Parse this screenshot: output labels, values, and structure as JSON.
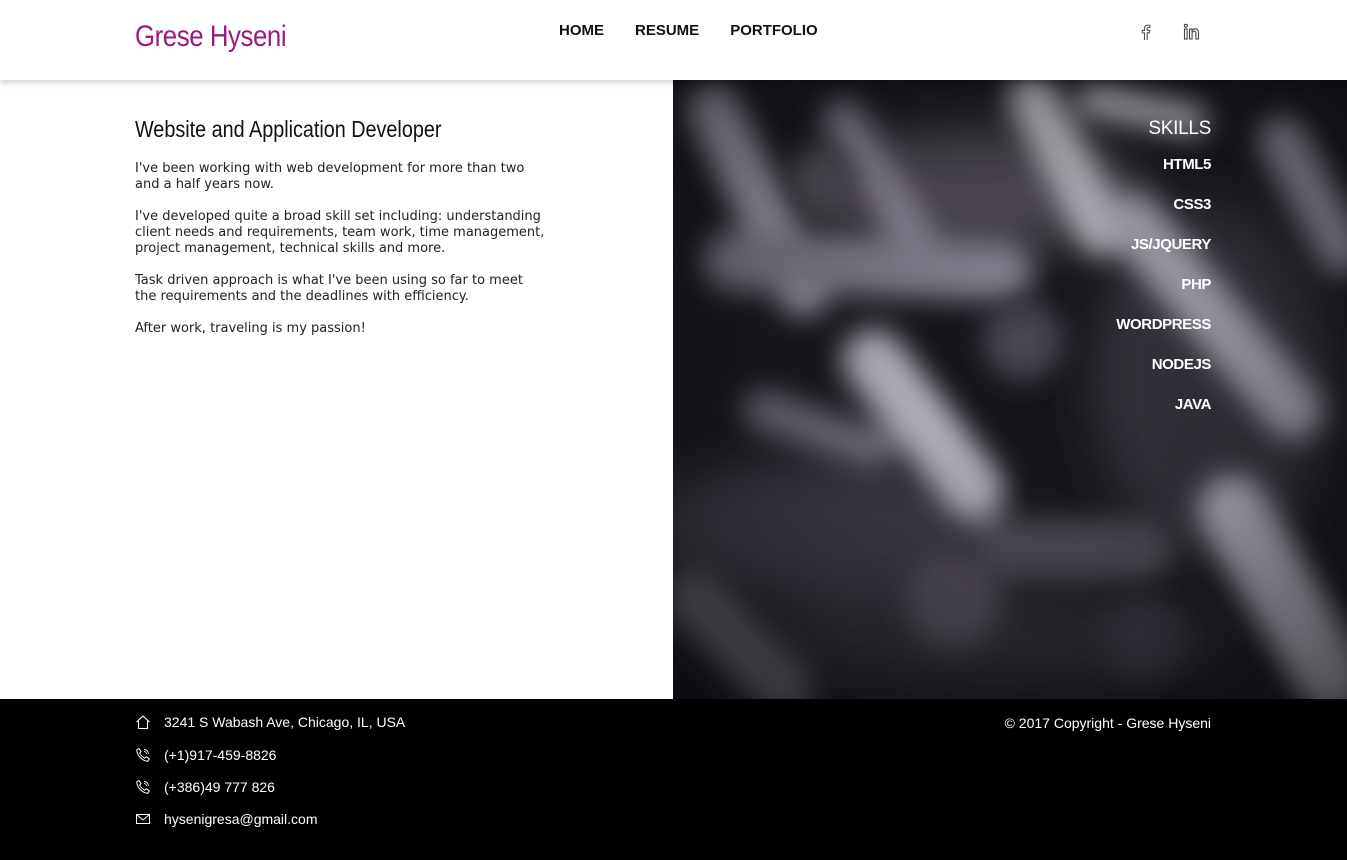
{
  "header": {
    "logo": "Grese Hyseni",
    "nav": [
      "HOME",
      "RESUME",
      "PORTFOLIO"
    ],
    "social_icons": [
      "facebook-icon",
      "linkedin-icon"
    ]
  },
  "about": {
    "title": "Website and Application Developer",
    "paragraphs": [
      "I've been working with web development for more than two and a half years now.",
      "I've developed quite a broad skill set including: understanding client needs and requirements, team work, time management, project management, technical skills and more.",
      "Task driven approach is what I've been using so far to meet the requirements and the deadlines with efficiency.",
      "After work, traveling is my passion!"
    ]
  },
  "skills": {
    "title": "SKILLS",
    "items": [
      "HTML5",
      "CSS3",
      "JS/JQUERY",
      "PHP",
      "WORDPRESS",
      "NODEJS",
      "JAVA"
    ]
  },
  "footer": {
    "contacts": [
      {
        "icon": "home-icon",
        "text": "3241 S Wabash Ave, Chicago, IL, USA"
      },
      {
        "icon": "phone-icon",
        "text": "(+1)917-459-8826"
      },
      {
        "icon": "phone-icon",
        "text": "(+386)49 777 826"
      },
      {
        "icon": "mail-icon",
        "text": "hysenigresa@gmail.com"
      }
    ],
    "copyright": "© 2017 Copyright - Grese Hyseni"
  },
  "colors": {
    "brand": "#9b1c78",
    "footer_bg": "#000000",
    "header_bg": "#ffffff"
  }
}
